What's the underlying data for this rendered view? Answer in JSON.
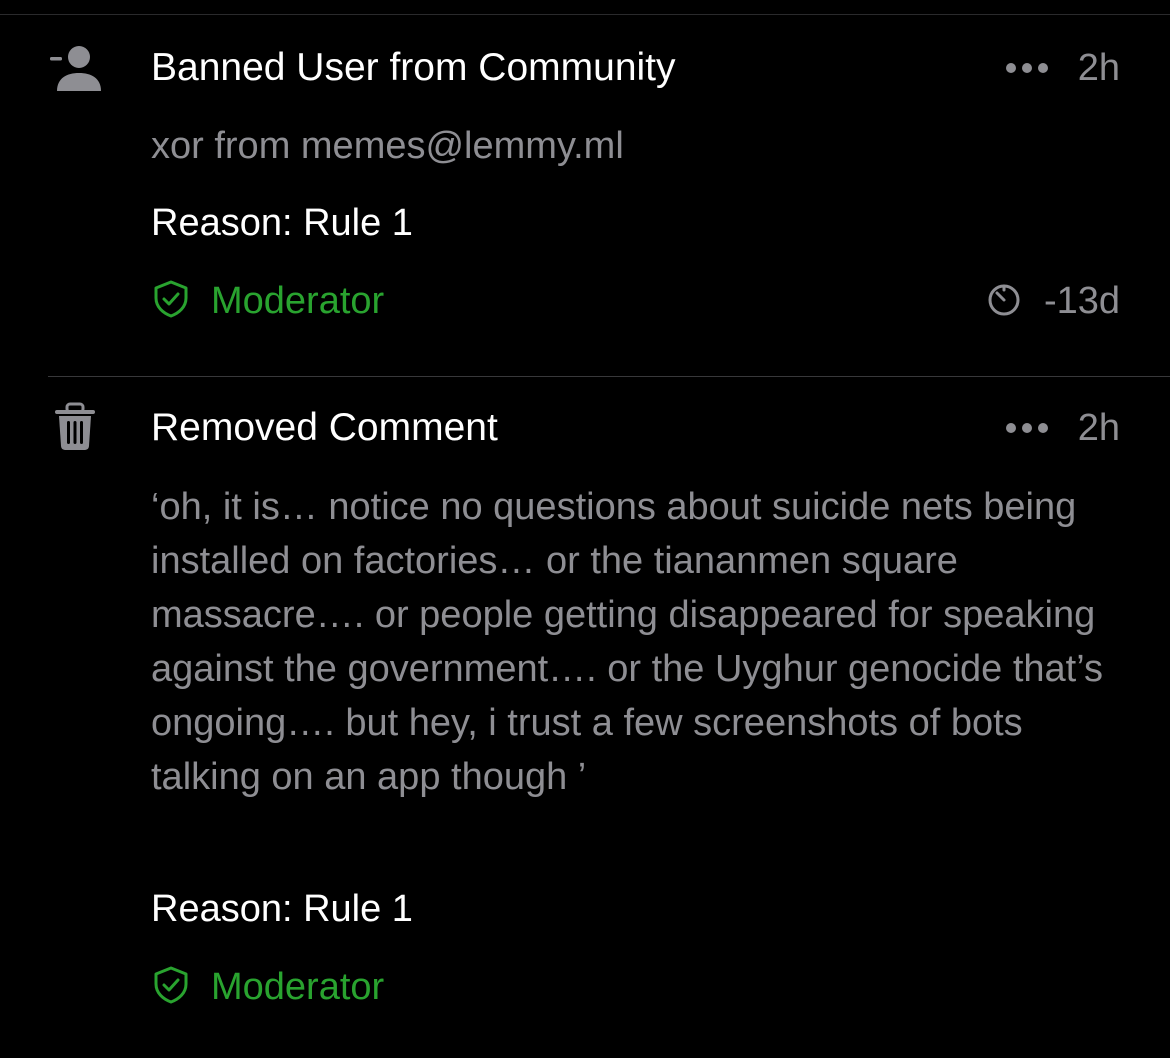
{
  "entries": [
    {
      "icon": "person-minus-icon",
      "title": "Banned User from Community",
      "time": "2h",
      "subtitle": "xor from memes@lemmy.ml",
      "reason": "Reason: Rule 1",
      "moderator_label": "Moderator",
      "expiry": "-13d",
      "expiry_icon": "timer-icon"
    },
    {
      "icon": "trash-icon",
      "title": "Removed Comment",
      "time": "2h",
      "body": "‘oh, it is… notice no questions about suicide nets being installed on factories… or the tiananmen square massacre…. or people getting disappeared for speaking against the government…. or the Uyghur genocide that’s ongoing…. but hey, i trust a few screenshots of bots talking on an app though ’",
      "reason": "Reason: Rule 1",
      "moderator_label": "Moderator"
    }
  ],
  "colors": {
    "background": "#000000",
    "primary_text": "#ffffff",
    "secondary_text": "#8e8e93",
    "moderator_green": "#29a32f"
  }
}
